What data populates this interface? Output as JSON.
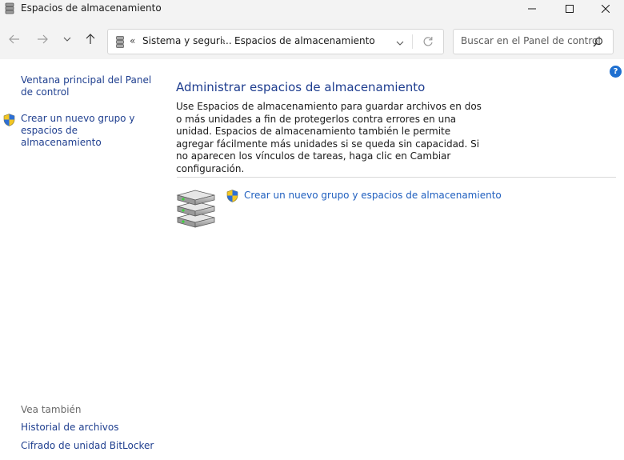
{
  "window": {
    "title": "Espacios de almacenamiento"
  },
  "address_bar": {
    "crumb_separator": "«",
    "crumbs": [
      "Sistema y seguri...",
      "Espacios de almacenamiento"
    ],
    "crumb_arrow": "›"
  },
  "search": {
    "placeholder": "Buscar en el Panel de control"
  },
  "help": {
    "label": "?"
  },
  "sidebar": {
    "home_link": "Ventana principal del Panel de control",
    "create_link": "Crear un nuevo grupo y espacios de almacenamiento",
    "see_also_heading": "Vea también",
    "see_also_items": [
      "Historial de archivos",
      "Cifrado de unidad BitLocker"
    ]
  },
  "main": {
    "heading": "Administrar espacios de almacenamiento",
    "description": "Use Espacios de almacenamiento para guardar archivos en dos o más unidades a fin de protegerlos contra errores en una unidad. Espacios de almacenamiento también le permite agregar fácilmente más unidades si se queda sin capacidad. Si no aparecen los vínculos de tareas, haga clic en Cambiar configuración.",
    "task_link": "Crear un nuevo grupo y espacios de almacenamiento"
  },
  "colors": {
    "link": "#1f3f8f",
    "heading": "#1e3d8f",
    "chrome_bg": "#f3f3f3",
    "help_badge": "#1e6fd0"
  }
}
